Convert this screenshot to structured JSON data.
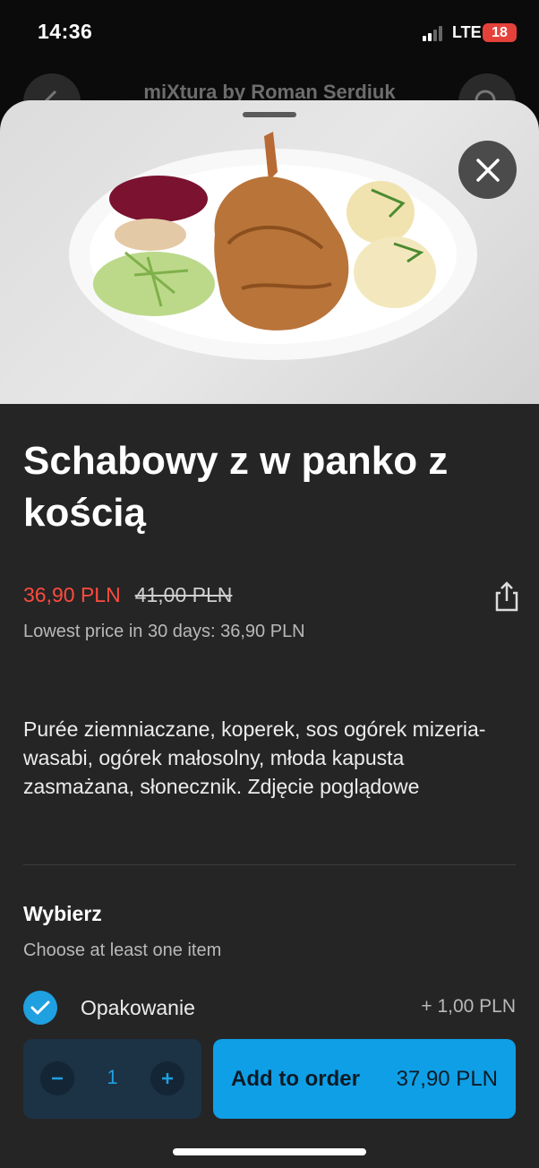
{
  "status_bar": {
    "time": "14:36",
    "network": "LTE",
    "battery": "18"
  },
  "background_header": {
    "title": "miXtura by Roman Serdiuk"
  },
  "product": {
    "title": "Schabowy z w panko z kością",
    "price_current": "36,90 PLN",
    "price_old": "41,00 PLN",
    "lowest_price_note": "Lowest price in 30 days: 36,90 PLN",
    "description": "Purée ziemniaczane, koperek, sos ogórek mizeria- wasabi, ogórek małosolny, młoda kapusta zasmażana, słonecznik. Zdjęcie poglądowe"
  },
  "options_section": {
    "title": "Wybierz",
    "subtitle": "Choose at least one item",
    "items": [
      {
        "label": "Opakowanie",
        "price": "+ 1,00 PLN",
        "checked": true
      }
    ]
  },
  "order_bar": {
    "quantity": "1",
    "add_label": "Add to order",
    "total": "37,90 PLN"
  },
  "colors": {
    "accent": "#0f9fe6",
    "sale_price": "#ff4b3e",
    "sheet_bg": "#252525"
  },
  "icons": {
    "back": "back-arrow-icon",
    "search": "search-icon",
    "close": "close-icon",
    "share": "share-icon",
    "check": "checkmark-icon",
    "minus": "minus-icon",
    "plus": "plus-icon"
  }
}
